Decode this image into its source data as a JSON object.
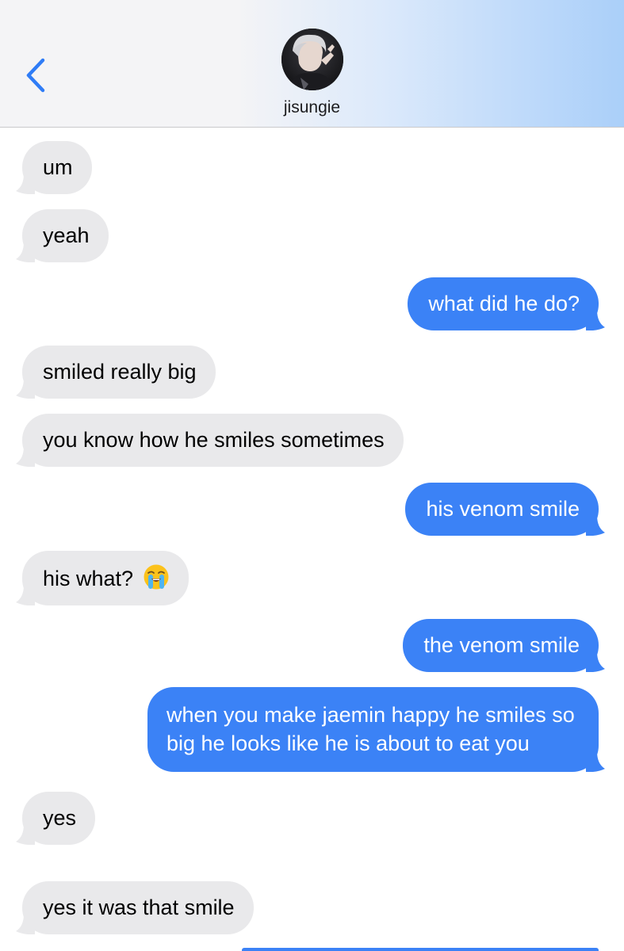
{
  "header": {
    "contact_name": "jisungie",
    "back_icon": "chevron-left-icon",
    "accent_color": "#3b82f6"
  },
  "messages": [
    {
      "side": "in",
      "text": "um"
    },
    {
      "side": "in",
      "text": "yeah"
    },
    {
      "side": "out",
      "text": "what did he do?"
    },
    {
      "side": "in",
      "text": "smiled really big"
    },
    {
      "side": "in",
      "text": "you know how he smiles sometimes"
    },
    {
      "side": "out",
      "text": "his venom smile"
    },
    {
      "side": "in",
      "text": "his what?",
      "emoji": "loudly-crying-face-icon"
    },
    {
      "side": "out",
      "text": "the venom smile"
    },
    {
      "side": "out",
      "text": "when you make jaemin happy he smiles so big he looks like he is about to eat you"
    },
    {
      "side": "in",
      "text": "yes"
    },
    {
      "side": "in",
      "text": "yes it was that smile"
    }
  ],
  "colors": {
    "incoming_bubble": "#e9e9eb",
    "outgoing_bubble": "#3b82f6"
  }
}
